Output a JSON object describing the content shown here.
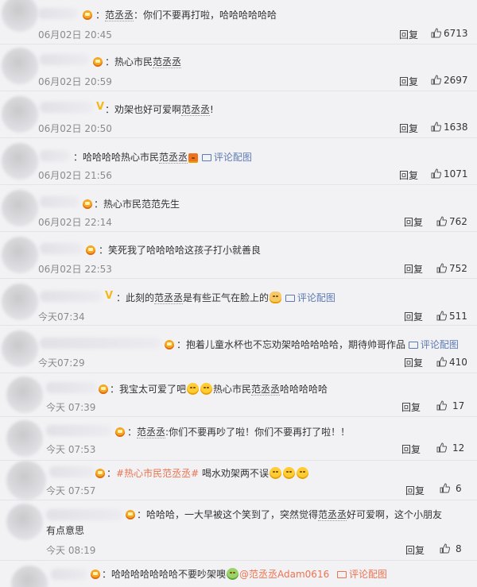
{
  "comments": [
    {
      "text": "：你们不要再打啦，哈哈哈哈哈哈",
      "mention": "范丞丞",
      "time": "06月02日 20:45",
      "reply": "回复",
      "likes": "6713"
    },
    {
      "text": "：热心市民",
      "mention": "范丞丞",
      "time": "06月02日 20:59",
      "reply": "回复",
      "likes": "2697"
    },
    {
      "text": "：劝架也好可爱啊",
      "mention": "范丞丞",
      "suffix": "!",
      "time": "06月02日 20:50",
      "reply": "回复",
      "likes": "1638"
    },
    {
      "text": "：哈哈哈哈热心市民",
      "mention": "范丞丞",
      "pic": "评论配图",
      "time": "06月02日 21:56",
      "reply": "回复",
      "likes": "1071"
    },
    {
      "text": "：热心市民范范先生",
      "time": "06月02日 22:14",
      "reply": "回复",
      "likes": "762"
    },
    {
      "text": "：笑死我了哈哈哈哈这孩子打小就善良",
      "time": "06月02日 22:53",
      "reply": "回复",
      "likes": "752"
    },
    {
      "text": "：此刻的",
      "mention": "范丞丞",
      "suffix": "是有些正气在脸上的",
      "pic": "评论配图",
      "time": "今天07:34",
      "reply": "回复",
      "likes": "511"
    },
    {
      "text": "：抱着儿童水杯也不忘劝架哈哈哈哈哈，期待帅哥作品",
      "pic": "评论配图",
      "time": "今天07:29",
      "reply": "回复",
      "likes": "410"
    },
    {
      "text": "：我宝太可爱了吧",
      "suffix": "热心市民",
      "mention": "范丞丞",
      "suffix2": "哈哈哈哈哈",
      "time": "今天 07:39",
      "reply": "回复",
      "likes": "17"
    },
    {
      "text": "：",
      "mention": "范丞丞",
      "suffix": ":你们不要再吵了啦！你们不要再打了啦！！",
      "time": "今天 07:53",
      "reply": "回复",
      "likes": "12"
    },
    {
      "text": "：",
      "link": "#热心市民范丞丞#",
      "suffix": " 喝水劝架两不误",
      "time": "今天 07:57",
      "reply": "回复",
      "likes": "6"
    },
    {
      "text": "：哈哈哈，一大早被这个笑到了，突然觉得",
      "mention": "范丞丞",
      "suffix": "好可爱啊，这个小朋友有点意思",
      "time": "今天 08:19",
      "reply": "回复",
      "likes": "8"
    },
    {
      "text": "：哈哈哈哈哈哈哈不要吵架噢",
      "mention": "@范丞丞Adam0616",
      "pic": "评论配图"
    }
  ],
  "colors": {
    "background": "#f2f2f5",
    "link": "#eb7350",
    "pic": "#5c7bb1",
    "badge": "#f5a623"
  }
}
